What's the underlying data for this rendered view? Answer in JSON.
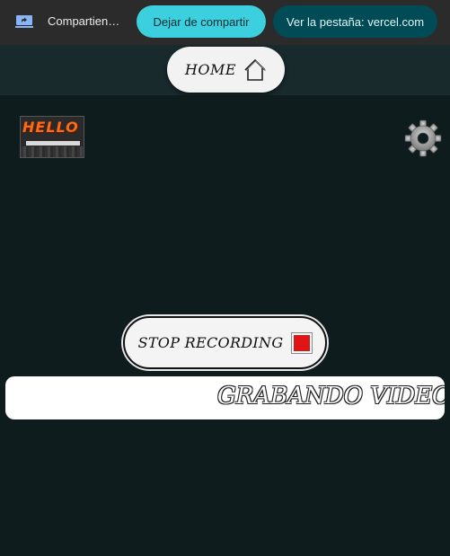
{
  "share_bar": {
    "status_text": "Compartien…",
    "stop_sharing_label": "Dejar de compartir",
    "view_tab_label": "Ver la pestaña: vercel.com",
    "icon": "screen-share-icon",
    "accent_color": "#3cd0de",
    "dark_button_color": "#004b55"
  },
  "nav": {
    "home_label": "HOME",
    "home_icon": "house-icon"
  },
  "thumbnail": {
    "title": "HELLO",
    "title_color": "#ff6a14"
  },
  "settings": {
    "icon": "gear-icon"
  },
  "recording": {
    "stop_label": "STOP RECORDING",
    "stop_icon": "red-square-icon",
    "stop_color": "#e01515",
    "banner_text": "GRABANDO VIDEO CON"
  }
}
